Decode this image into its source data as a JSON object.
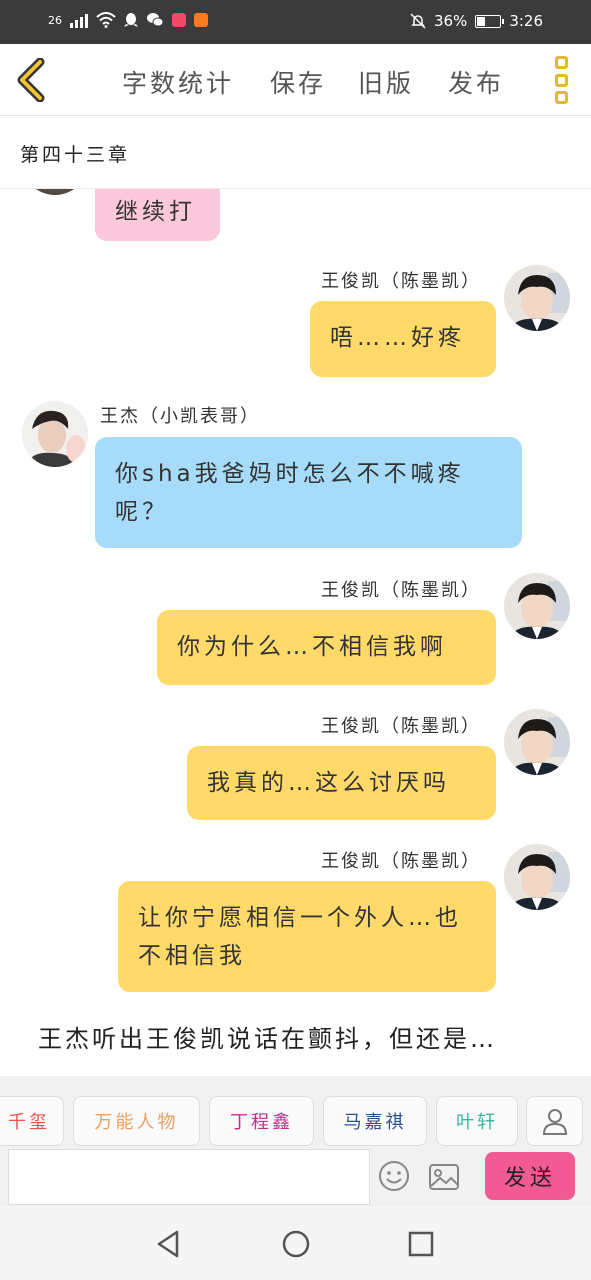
{
  "status_bar": {
    "network": "26",
    "battery": "36%",
    "battery_level": 0.36,
    "time": "3:26"
  },
  "toolbar": {
    "back_icon": "chevron-left-icon",
    "word_count": "字数统计",
    "save": "保存",
    "old_version": "旧版",
    "publish": "发布",
    "more_icon": "more-vertical-icon"
  },
  "chapter": {
    "title": "第四十三章"
  },
  "chat": {
    "messages": [
      {
        "speaker": "",
        "side": "left",
        "color": "pink",
        "text": "继续打"
      },
      {
        "speaker": "王俊凯（陈墨凯）",
        "side": "right",
        "color": "yellow",
        "text": "唔……好疼"
      },
      {
        "speaker": "王杰（小凯表哥）",
        "side": "left",
        "color": "blue",
        "text": "你sha我爸妈时怎么不不喊疼呢？"
      },
      {
        "speaker": "王俊凯（陈墨凯）",
        "side": "right",
        "color": "yellow",
        "text": "你为什么…不相信我啊"
      },
      {
        "speaker": "王俊凯（陈墨凯）",
        "side": "right",
        "color": "yellow",
        "text": "我真的…这么讨厌吗"
      },
      {
        "speaker": "王俊凯（陈墨凯）",
        "side": "right",
        "color": "yellow",
        "text": "让你宁愿相信一个外人…也不相信我"
      }
    ],
    "narration": "王杰听出王俊凯说话在颤抖，但还是…"
  },
  "characters": [
    {
      "name": "千玺",
      "color": "#e8534d"
    },
    {
      "name": "万能人物",
      "color": "#e8a060"
    },
    {
      "name": "丁程鑫",
      "color": "#c42f8c"
    },
    {
      "name": "马嘉祺",
      "color": "#2a4f8f"
    },
    {
      "name": "叶轩",
      "color": "#3bb3a3"
    }
  ],
  "input": {
    "placeholder": "",
    "send_label": "发送"
  },
  "colors": {
    "accent_yellow": "#ffda6b",
    "bubble_blue": "#a6dcfa",
    "bubble_pink": "#fcc8dc",
    "send_pink": "#f25a93",
    "more_icon": "#e0b92c"
  }
}
